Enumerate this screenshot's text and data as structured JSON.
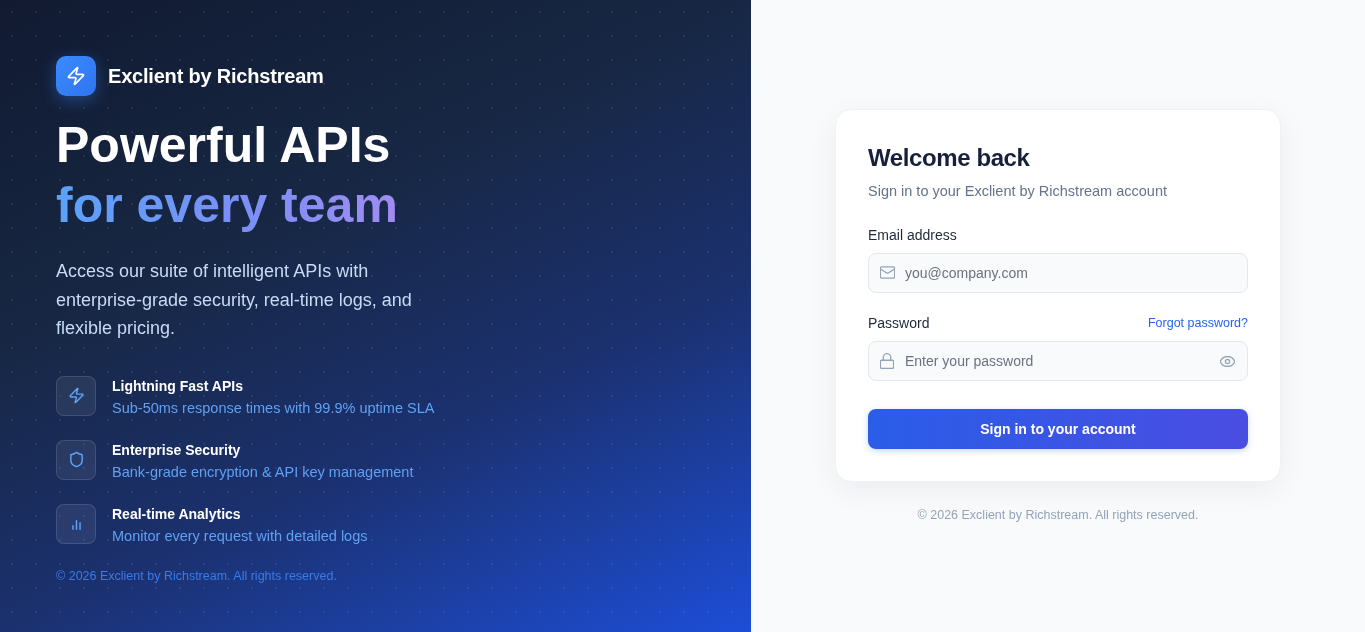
{
  "brand": {
    "name": "Exclient by Richstream"
  },
  "hero": {
    "headline": "Powerful APIs",
    "headline_accent": "for every team",
    "description": "Access our suite of intelligent APIs with enterprise-grade security, real-time logs, and flexible pricing.",
    "features": [
      {
        "title": "Lightning Fast APIs",
        "description": "Sub-50ms response times with 99.9% uptime SLA"
      },
      {
        "title": "Enterprise Security",
        "description": "Bank-grade encryption & API key management"
      },
      {
        "title": "Real-time Analytics",
        "description": "Monitor every request with detailed logs"
      }
    ],
    "copyright": "© 2026 Exclient by Richstream. All rights reserved."
  },
  "login": {
    "title": "Welcome back",
    "subtitle": "Sign in to your Exclient by Richstream account",
    "fields": [
      {
        "kind": "email",
        "label": "Email address",
        "placeholder": "you@company.com"
      },
      {
        "kind": "password",
        "label": "Password",
        "placeholder": "Enter your password",
        "link": "Forgot password?"
      }
    ],
    "submit": "Sign in to your account"
  },
  "footer": {
    "copyright": "© 2026 Exclient by Richstream. All rights reserved."
  }
}
